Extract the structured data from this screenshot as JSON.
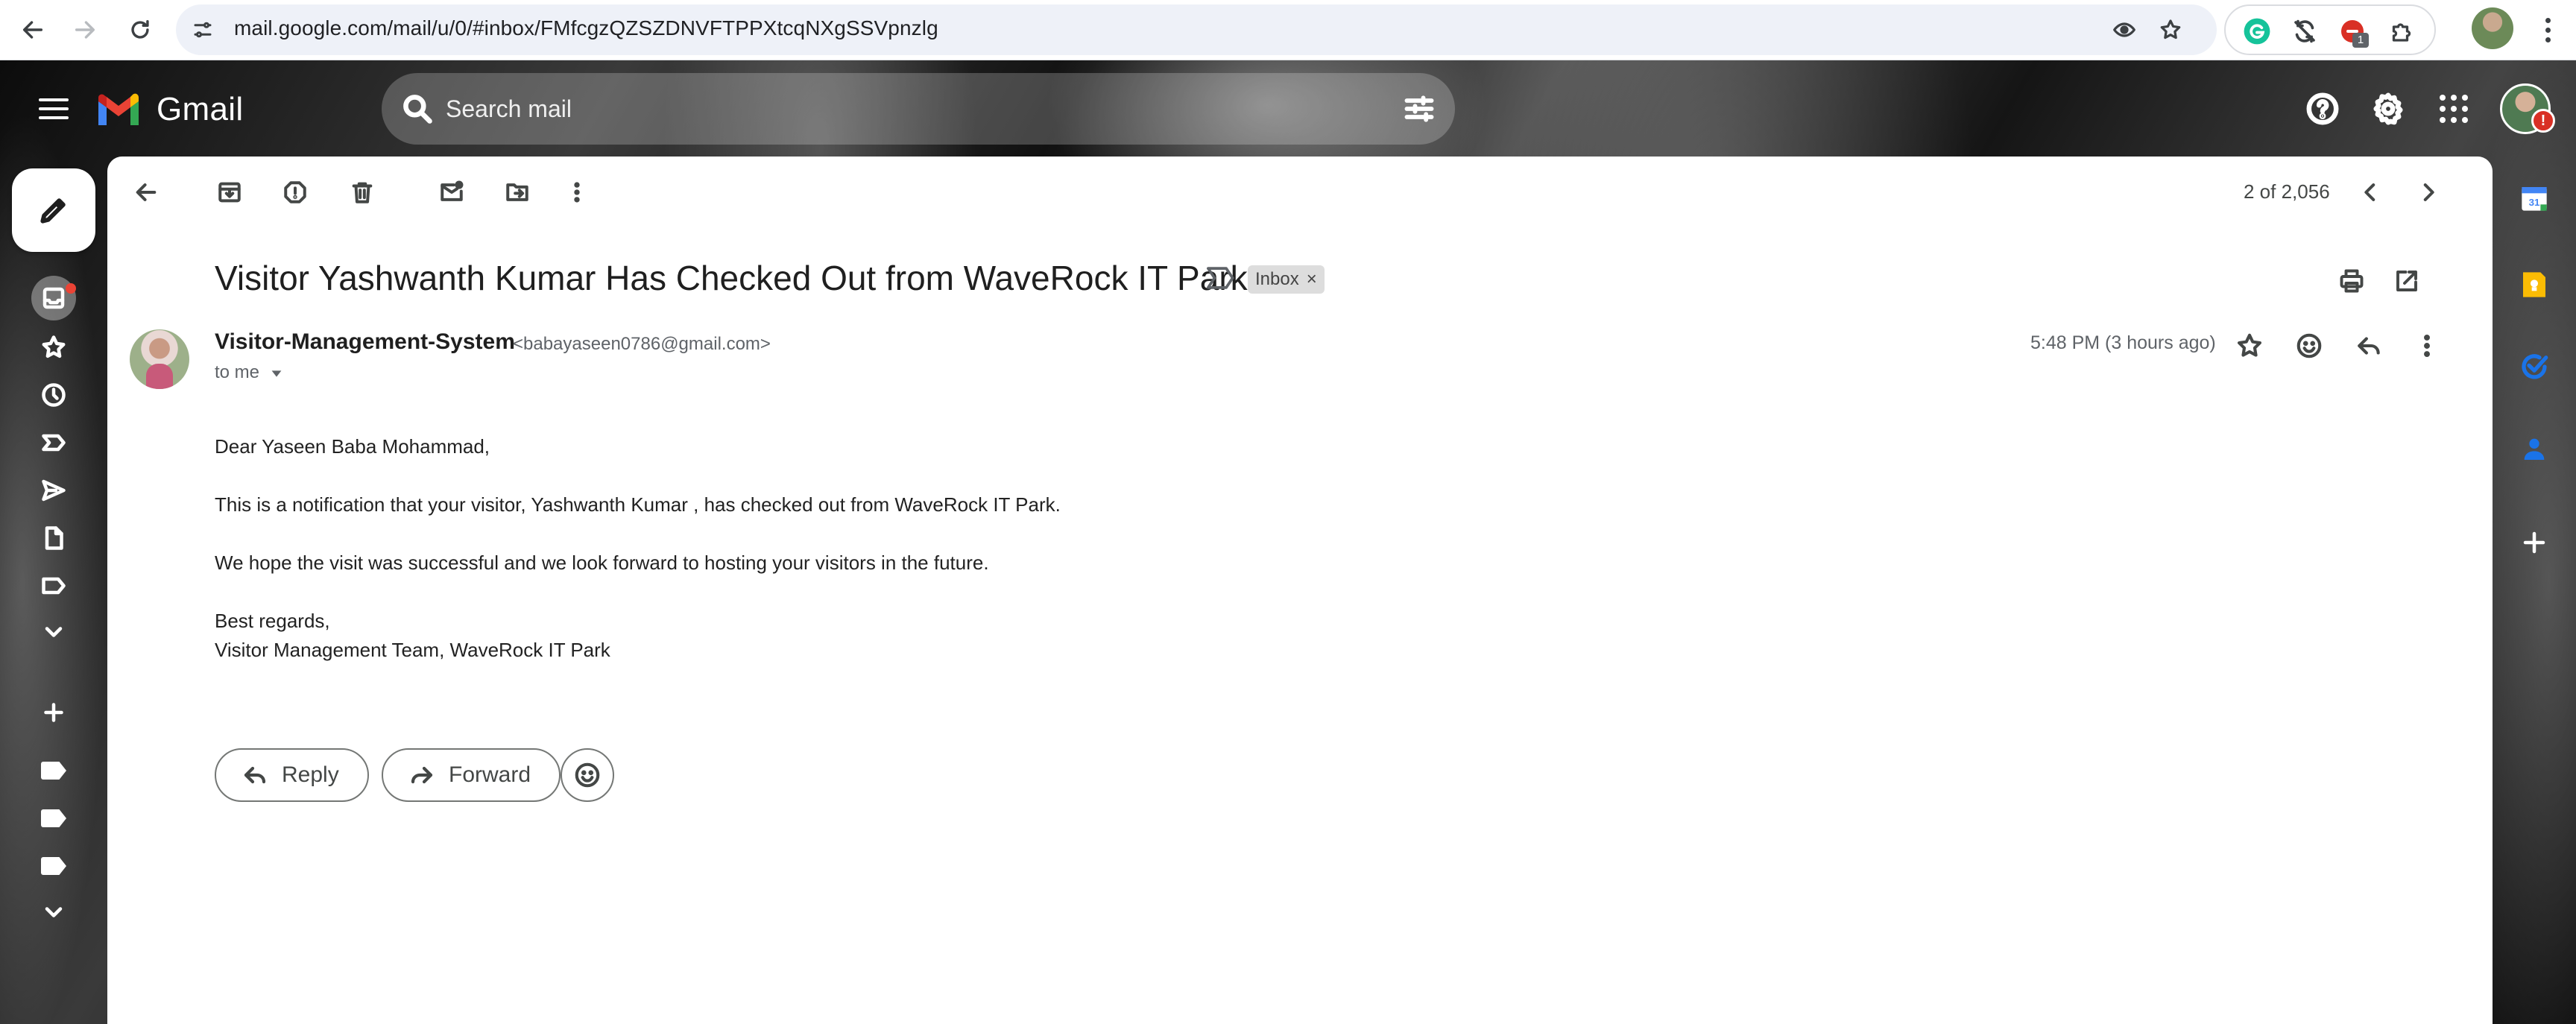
{
  "browser": {
    "url": "mail.google.com/mail/u/0/#inbox/FMfcgzQZSZDNVFTPPXtcqNXgSSVpnzlg",
    "extension_badge": "1"
  },
  "gmail": {
    "app_name": "Gmail",
    "search_placeholder": "Search mail"
  },
  "toolbar": {
    "pager": "2 of 2,056"
  },
  "email": {
    "subject": "Visitor Yashwanth Kumar Has Checked Out from WaveRock IT Park",
    "label_chip": "Inbox",
    "label_remove": "×",
    "sender_name": "Visitor-Management-System",
    "sender_email": "<babayaseen0786@gmail.com>",
    "recipient": "to me",
    "timestamp": "5:48 PM (3 hours ago)",
    "body": {
      "greeting": "Dear Yaseen Baba Mohammad,",
      "line1": "This is a notification that your visitor, Yashwanth Kumar , has checked out from WaveRock IT Park.",
      "line2": "We hope the visit was successful and we look forward to hosting your visitors in the future.",
      "closing": "Best regards,",
      "signature": "Visitor Management Team, WaveRock IT Park"
    }
  },
  "actions": {
    "reply": "Reply",
    "forward": "Forward"
  },
  "colors": {
    "gmail_red": "#EA4335",
    "gmail_blue": "#4285F4",
    "gmail_green": "#34A853",
    "gmail_yellow": "#FBBC04"
  }
}
